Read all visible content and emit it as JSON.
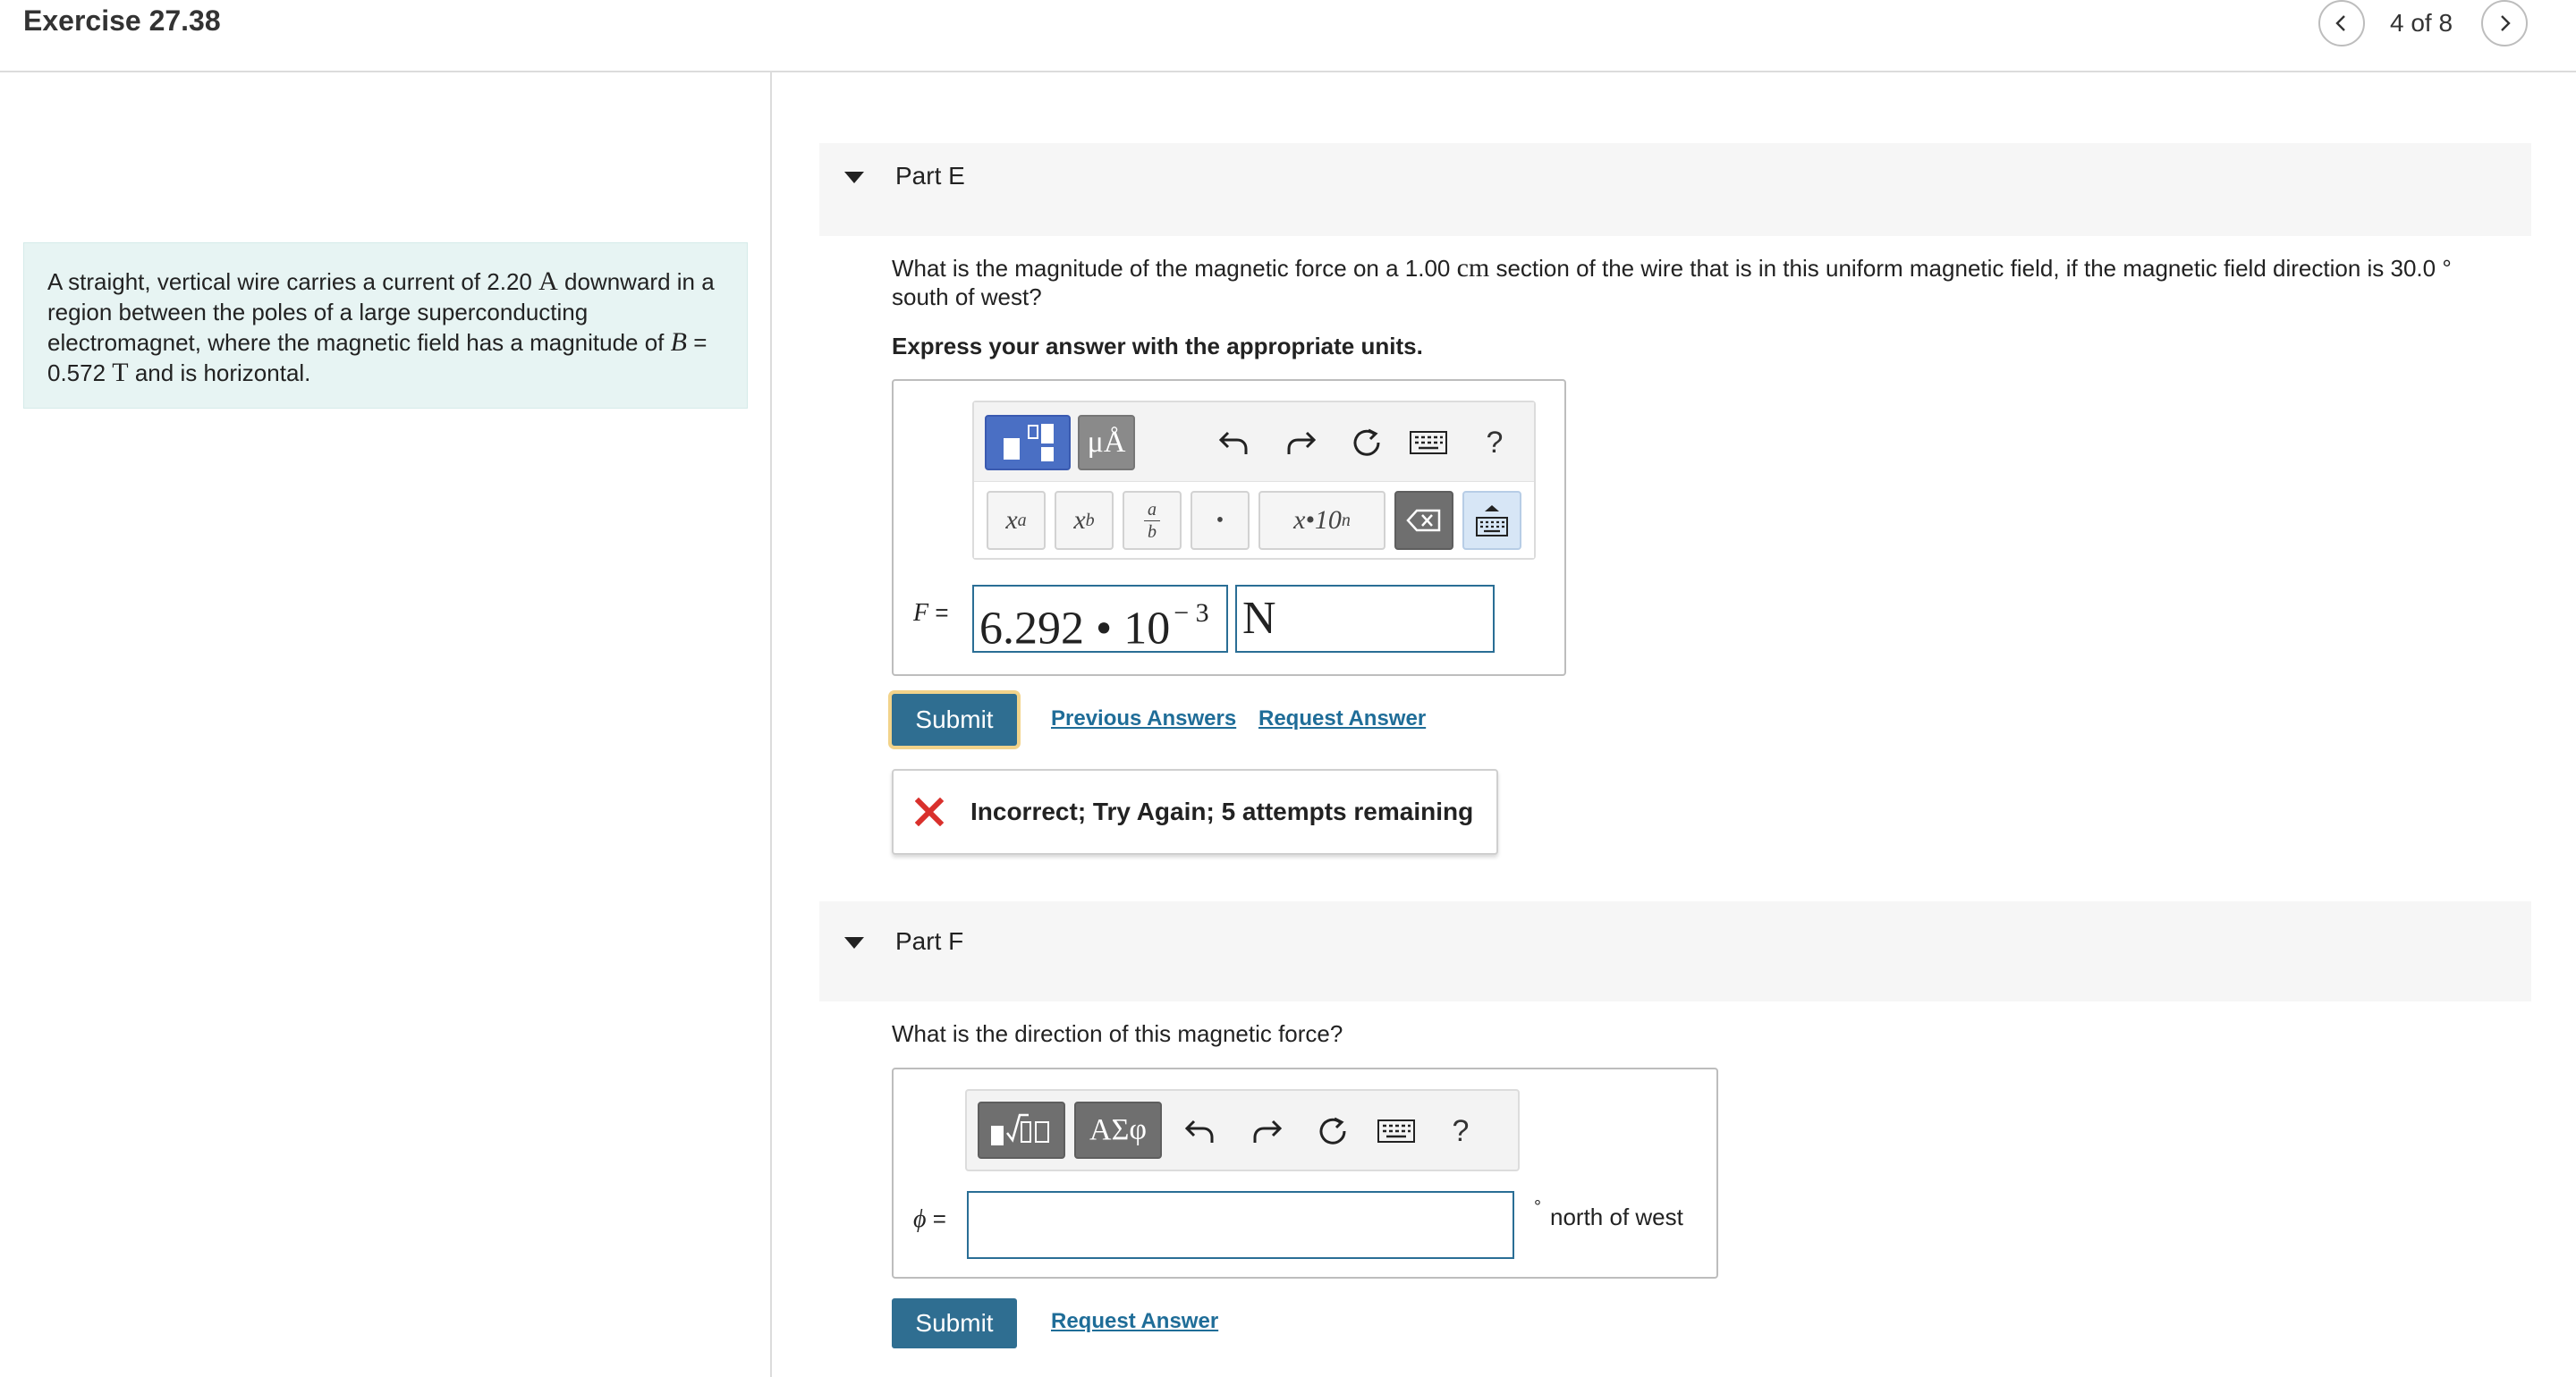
{
  "header": {
    "title": "Exercise 27.38",
    "page_count": "4 of 8",
    "prev_icon": "chevron-left-icon",
    "next_icon": "chevron-right-icon"
  },
  "problem": {
    "text_1": "A straight, vertical wire carries a current of 2.20 ",
    "unit_current": "A",
    "text_2": " downward in a region between the poles of a large superconducting electromagnet, where the magnetic field has a magnitude of ",
    "symbol_B": "B",
    "text_3": " = 0.572 ",
    "unit_field": "T",
    "text_4": " and is horizontal."
  },
  "part_e": {
    "label": "Part E",
    "question_1": "What is the magnitude of the magnetic force on a 1.00 ",
    "question_unit": "cm",
    "question_2": " section of the wire that is in this uniform magnetic field, if the magnetic field direction is 30.0 ° south of west?",
    "instruction": "Express your answer with the appropriate units.",
    "toolbar": {
      "units_button": "μÅ",
      "help": "?",
      "superscript": "x",
      "superscript_exp": "a",
      "subscript": "x",
      "subscript_sub": "b",
      "fraction_num": "a",
      "fraction_den": "b",
      "dot": "•",
      "sci_notation": "x•10",
      "sci_exp": "n"
    },
    "variable": "F",
    "equals": " =",
    "value": "6.292 • 10",
    "exponent": "− 3",
    "unit_value": "N",
    "submit_label": "Submit",
    "previous_answers": "Previous Answers",
    "request_answer": "Request Answer",
    "feedback": "Incorrect; Try Again; 5 attempts remaining"
  },
  "part_f": {
    "label": "Part F",
    "question": "What is the direction of this magnetic force?",
    "toolbar": {
      "greek_button": "ΑΣφ",
      "help": "?"
    },
    "variable": "ϕ",
    "equals": " =",
    "input_value": "",
    "unit_degree": "°",
    "unit_suffix": "north of west",
    "submit_label": "Submit",
    "request_answer": "Request Answer"
  },
  "colors": {
    "accent": "#2f6e91",
    "link": "#1f6d98",
    "problem_bg": "#e7f4f3",
    "error": "#d9302c"
  }
}
